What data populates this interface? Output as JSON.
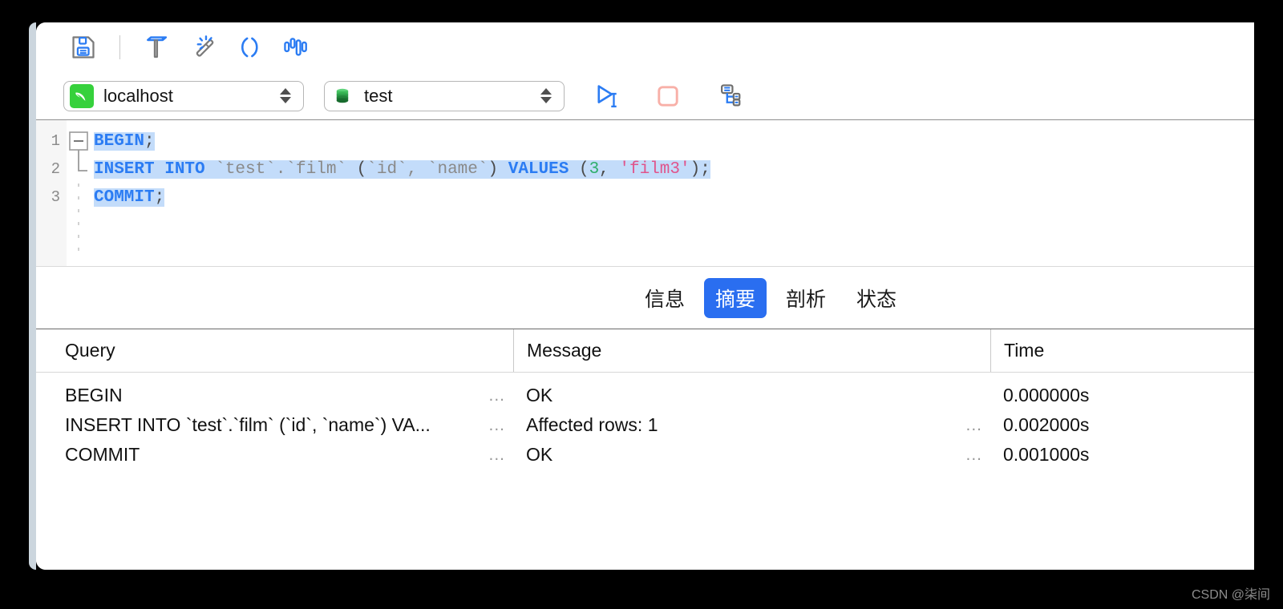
{
  "toolbar": {
    "buttons": [
      {
        "name": "save-icon",
        "label": "保存"
      },
      {
        "name": "beautify-icon",
        "label": "美化 SQL"
      },
      {
        "name": "magic-wand-icon",
        "label": "格式化"
      },
      {
        "name": "parentheses-icon",
        "label": "括号匹配"
      },
      {
        "name": "columns-icon",
        "label": "列信息"
      }
    ]
  },
  "connection": {
    "host": {
      "value": "localhost",
      "icon": "mysql-dolphin-icon",
      "icon_bg": "#36d13c"
    },
    "database": {
      "value": "test",
      "icon": "database-cylinder-icon",
      "icon_color": "#22a34a"
    },
    "run_label": "运行",
    "stop_label": "停止",
    "plan_label": "执行计划"
  },
  "editor": {
    "line_numbers": [
      "1",
      "2",
      "3"
    ],
    "lines": [
      {
        "raw": "BEGIN;"
      },
      {
        "raw": "INSERT INTO `test`.`film` (`id`, `name`) VALUES (3, 'film3');"
      },
      {
        "raw": "COMMIT;"
      }
    ],
    "tokens": {
      "l1": {
        "kw": "BEGIN",
        "punc": ";"
      },
      "l2": {
        "kw1": "INSERT INTO",
        "ident1": " `test`.`film` ",
        "punc1": "(",
        "ident2": "`id`, `name`",
        "punc2": ") ",
        "kw2": "VALUES",
        "punc3": " (",
        "num": "3",
        "punc4": ", ",
        "str": "'film3'",
        "punc5": ");"
      },
      "l3": {
        "kw": "COMMIT",
        "punc": ";"
      }
    },
    "colors": {
      "keyword": "#2b7cf3",
      "identifier": "#8a8a8a",
      "number": "#2fae6b",
      "string": "#e0558c",
      "selection": "#c3dcfa"
    }
  },
  "tabs": [
    {
      "label": "信息",
      "active": false
    },
    {
      "label": "摘要",
      "active": true
    },
    {
      "label": "剖析",
      "active": false
    },
    {
      "label": "状态",
      "active": false
    }
  ],
  "results": {
    "columns": [
      "Query",
      "Message",
      "Time"
    ],
    "rows": [
      {
        "query": "BEGIN",
        "query_truncated": true,
        "message": "OK",
        "message_truncated": false,
        "time": "0.000000s"
      },
      {
        "query": "INSERT INTO `test`.`film` (`id`, `name`) VA...",
        "query_truncated": true,
        "message": "Affected rows: 1",
        "message_truncated": true,
        "time": "0.002000s"
      },
      {
        "query": "COMMIT",
        "query_truncated": true,
        "message": "OK",
        "message_truncated": true,
        "time": "0.001000s"
      }
    ],
    "ellipsis": "..."
  },
  "watermark": "CSDN @柒间",
  "accent_color": "#2a6ef0"
}
